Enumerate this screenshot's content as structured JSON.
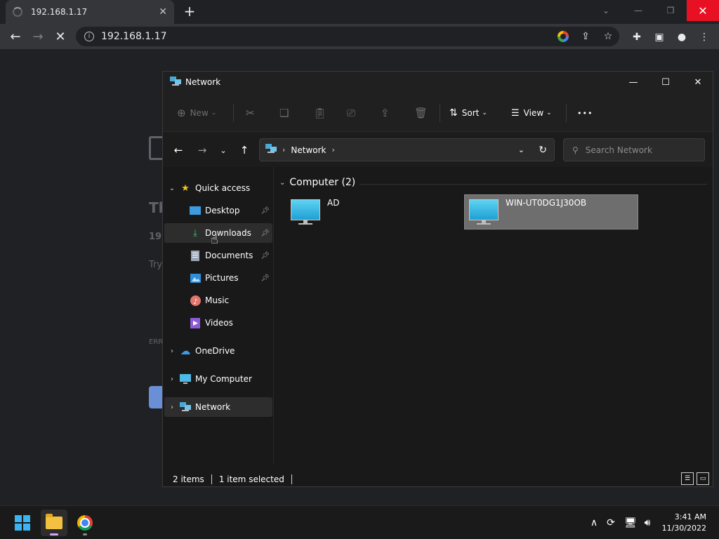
{
  "browser": {
    "tab_title": "192.168.1.17",
    "url": "192.168.1.17"
  },
  "background_page": {
    "fragments": [
      "Th",
      "192",
      "Try",
      "ERR"
    ]
  },
  "explorer": {
    "title": "Network",
    "commands": {
      "new": "New",
      "sort": "Sort",
      "view": "View",
      "more": "•••"
    },
    "address": {
      "segment": "Network"
    },
    "search": {
      "placeholder": "Search Network"
    },
    "nav": {
      "quick_access": "Quick access",
      "items": [
        {
          "label": "Desktop",
          "pinned": true
        },
        {
          "label": "Downloads",
          "pinned": true
        },
        {
          "label": "Documents",
          "pinned": true
        },
        {
          "label": "Pictures",
          "pinned": true
        },
        {
          "label": "Music",
          "pinned": false
        },
        {
          "label": "Videos",
          "pinned": false
        }
      ],
      "onedrive": "OneDrive",
      "my_computer": "My Computer",
      "network": "Network"
    },
    "content": {
      "group_header": "Computer (2)",
      "items": [
        {
          "name": "AD",
          "selected": false
        },
        {
          "name": "WIN-UT0DG1J30OB",
          "selected": true
        }
      ]
    },
    "status": {
      "count": "2 items",
      "selected": "1 item selected"
    }
  },
  "taskbar": {
    "time": "3:41 AM",
    "date": "11/30/2022"
  },
  "colors": {
    "accent": "#3ab4f2",
    "close_red": "#e81123",
    "selection": "#6e6e6e"
  }
}
